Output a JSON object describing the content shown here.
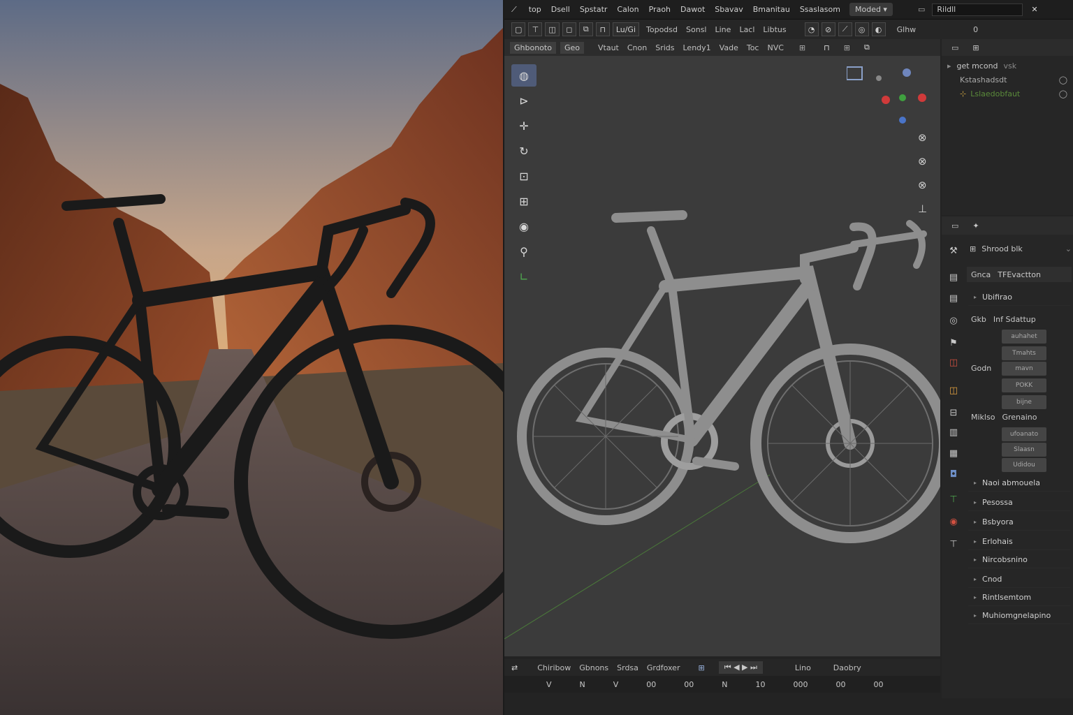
{
  "topbar": {
    "menus": [
      "top",
      "Dsell",
      "Spstatr",
      "Calon",
      "Praoh",
      "Dawot",
      "Sbavav",
      "Bmanitau",
      "Ssaslasom"
    ],
    "workspace": "Moded",
    "search_value": "Rildll"
  },
  "toolbar": {
    "buttons": [
      "Lu/Gi"
    ],
    "labels": [
      "Topodsd",
      "Sonsl",
      "Line",
      "Lacl",
      "Libtus"
    ],
    "right_label": "Glhw",
    "right_value": "0"
  },
  "header2": {
    "mode": "Ghbonoto",
    "mode2": "Geo",
    "items": [
      "Vtaut",
      "Cnon",
      "Srids",
      "Lendy1",
      "Vade",
      "Toc",
      "NVC"
    ]
  },
  "outliner": {
    "rows": [
      {
        "label": "get mcond",
        "suffix": "vsk"
      },
      {
        "label": "Kstashadsdt",
        "suffix": ""
      },
      {
        "label": "Lslaedobfaut",
        "suffix": ""
      }
    ]
  },
  "properties": {
    "title": "Shrood blk",
    "tab_a": "Gnca",
    "tab_b": "TFEvactton",
    "section1": "Ubifirao",
    "group1": {
      "label": "Gkb",
      "header": "Inf Sdattup",
      "fields": [
        "auhahet",
        "Tmahts"
      ]
    },
    "group2": {
      "label": "Godn",
      "fields": [
        "mavn",
        "POKK",
        "bijne"
      ]
    },
    "group3": {
      "label": "Miklso",
      "header": "Grenaino",
      "fields": [
        "ufoanato",
        "Slaasn",
        "Udidou"
      ]
    },
    "collapsed": [
      "Naoi abmouela",
      "Pesossa",
      "Bsbyora",
      "Erlohais",
      "Nircobsnino",
      "Cnod",
      "Rintlsemtom",
      "Muhiomgnelapino"
    ]
  },
  "timeline": {
    "items": [
      "Chiribow",
      "Gbnons",
      "Srdsa",
      "Grdfoxer"
    ],
    "right_a": "Lino",
    "right_b": "Daobry",
    "frames": [
      "V",
      "N",
      "V",
      "00",
      "00",
      "N",
      "10",
      "000",
      "00",
      "00"
    ]
  },
  "colors": {
    "bg": "#232323",
    "viewport": "#3b3b3b",
    "active_tool": "#4f5b78",
    "axis_x": "#d03a3a",
    "axis_y": "#3fa03f",
    "axis_z": "#4a74c8"
  }
}
